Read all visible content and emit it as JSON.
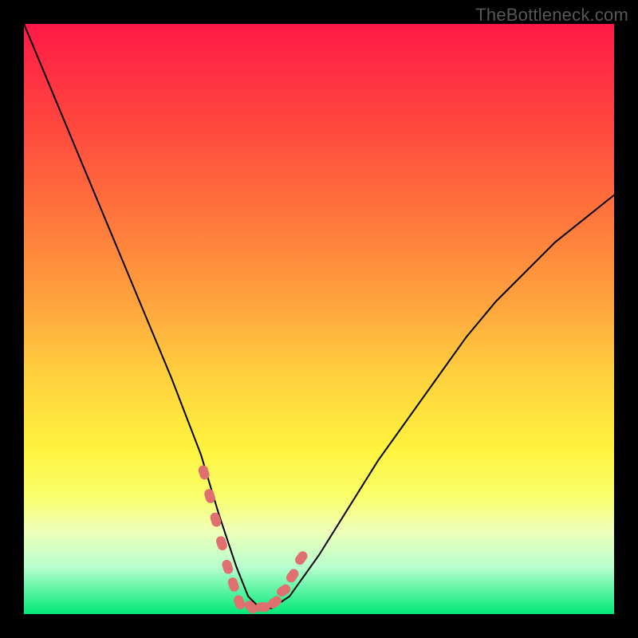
{
  "watermark": "TheBottleneck.com",
  "chart_data": {
    "type": "line",
    "title": "",
    "xlabel": "",
    "ylabel": "",
    "xlim": [
      0,
      100
    ],
    "ylim": [
      0,
      100
    ],
    "series": [
      {
        "name": "bottleneck-curve",
        "x": [
          0,
          5,
          10,
          15,
          20,
          25,
          30,
          33,
          36,
          38,
          40,
          42,
          45,
          50,
          55,
          60,
          65,
          70,
          75,
          80,
          85,
          90,
          95,
          100
        ],
        "values": [
          100,
          88,
          76,
          64,
          52,
          40,
          27,
          17,
          8,
          3,
          1,
          1,
          3,
          10,
          18,
          26,
          33,
          40,
          47,
          53,
          58,
          63,
          67,
          71
        ]
      },
      {
        "name": "marker-left",
        "x": [
          30.5,
          31.5,
          32.5,
          33.5,
          34.5,
          35.5
        ],
        "values": [
          24,
          20,
          16,
          12,
          8,
          5
        ]
      },
      {
        "name": "marker-bottom",
        "x": [
          36.5,
          38.5,
          40.5,
          42.5
        ],
        "values": [
          2,
          1.2,
          1.2,
          2
        ]
      },
      {
        "name": "marker-right",
        "x": [
          44.0,
          45.5,
          47.0
        ],
        "values": [
          4,
          6.5,
          9.5
        ]
      }
    ],
    "grid": false,
    "legend": false,
    "background_gradient": {
      "top": "#ff1846",
      "upper_mid": "#ff7a3c",
      "mid": "#ffd23e",
      "lower_mid": "#fff33e",
      "bottom": "#00e977"
    },
    "marker_color": "#e07070",
    "curve_color": "#000000"
  }
}
